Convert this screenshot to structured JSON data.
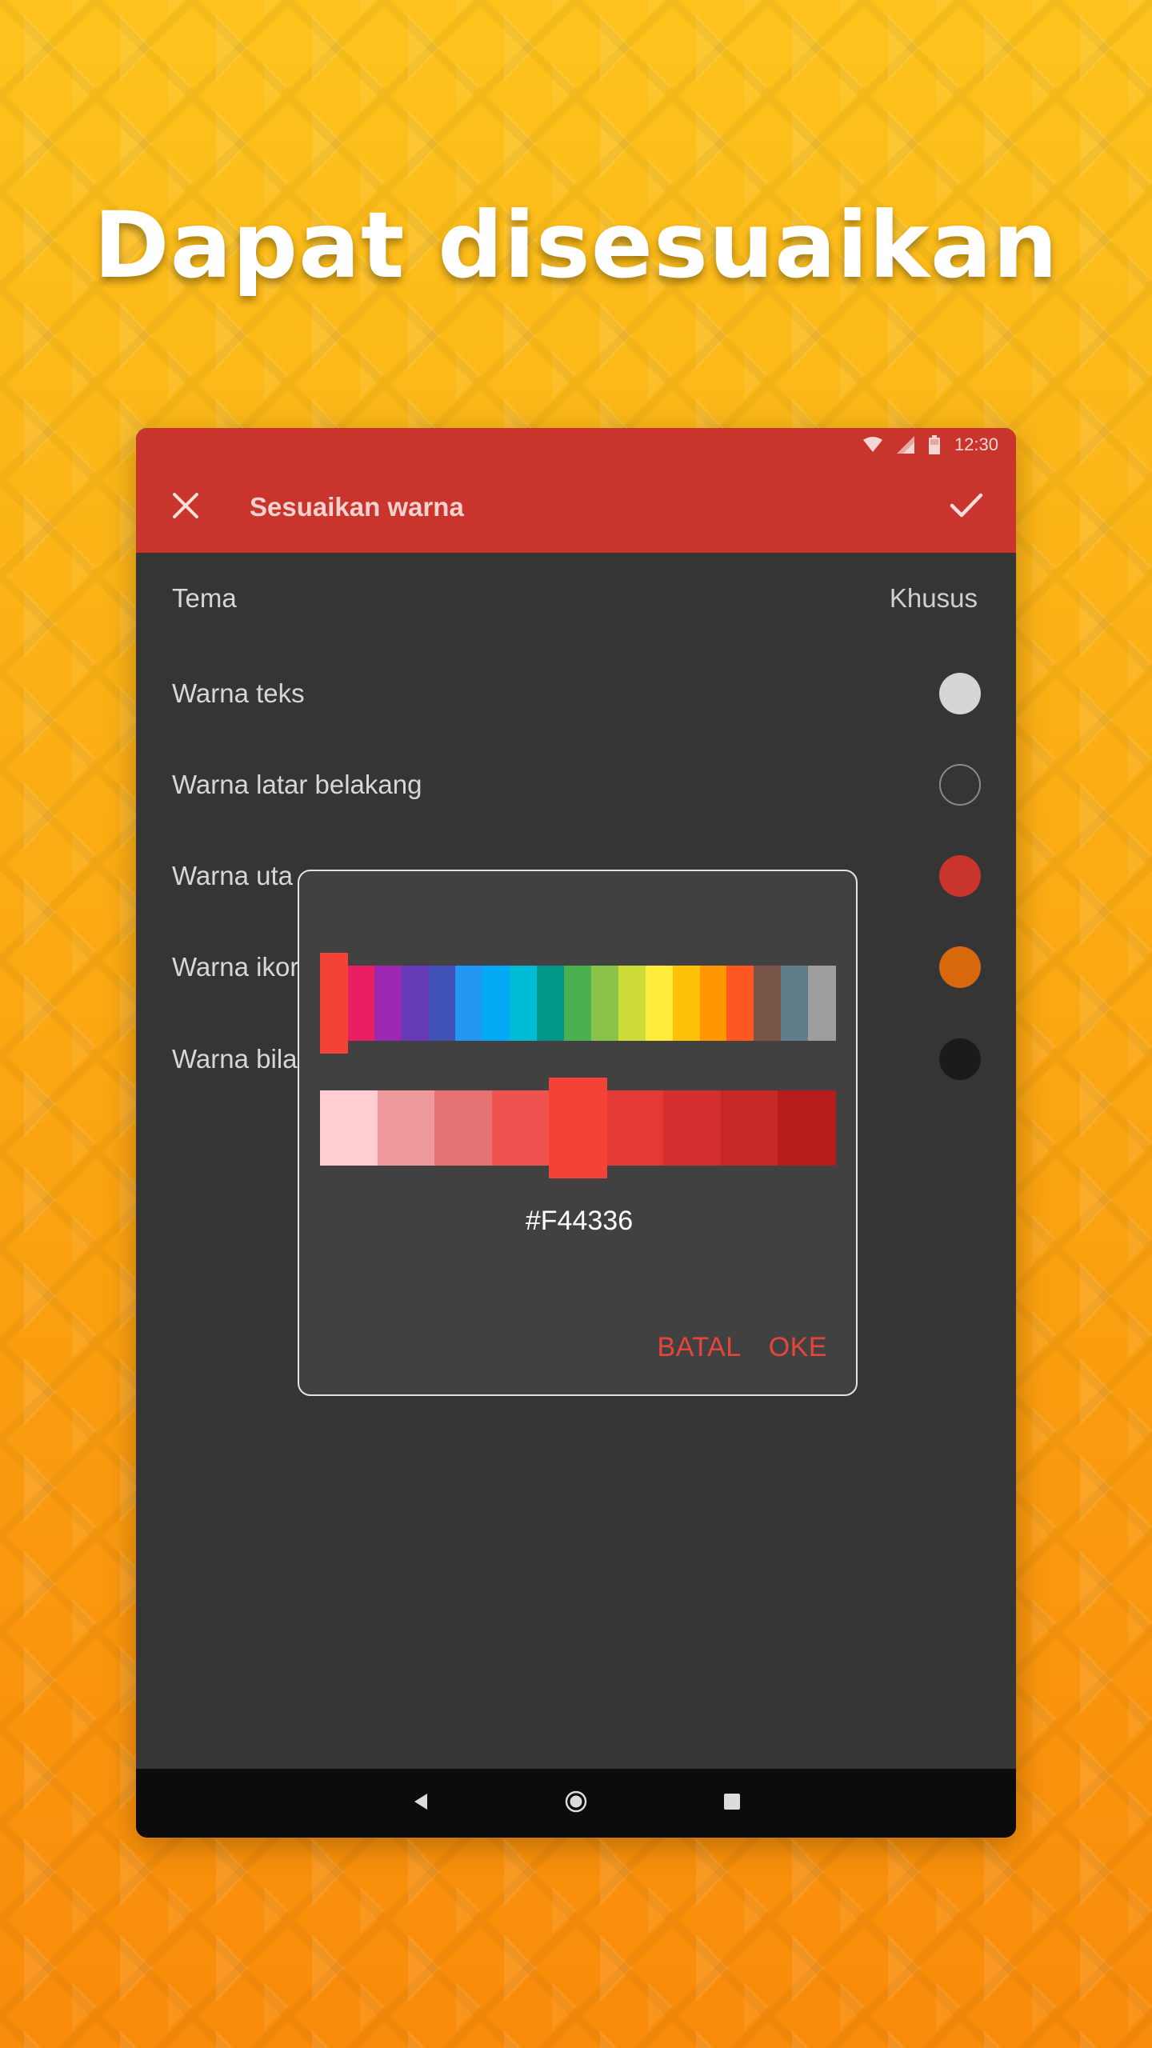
{
  "headline": "Dapat disesuaikan",
  "status_bar": {
    "time": "12:30",
    "icons": [
      "wifi-icon",
      "signal-icon",
      "battery-icon"
    ]
  },
  "app_bar": {
    "title": "Sesuaikan warna",
    "close_icon": "close-icon",
    "confirm_icon": "check-icon"
  },
  "settings": [
    {
      "label": "Tema",
      "value": "Khusus"
    },
    {
      "label": "Warna teks",
      "swatch": "#d6d6d6"
    },
    {
      "label": "Warna latar belakang",
      "swatch": "#363536"
    },
    {
      "label": "Warna uta",
      "swatch": "#c9342c"
    },
    {
      "label": "Warna ikor",
      "swatch": "#d7680c"
    },
    {
      "label": "Warna bila",
      "swatch": "#1b1b1b"
    }
  ],
  "color_dialog": {
    "palette": [
      "#f44336",
      "#e91e63",
      "#9c27b0",
      "#673ab7",
      "#3f51b5",
      "#2196f3",
      "#03a9f4",
      "#00bcd4",
      "#009688",
      "#4caf50",
      "#8bc34a",
      "#cddc39",
      "#ffeb3b",
      "#ffc107",
      "#ff9800",
      "#ff5722",
      "#795548",
      "#607d8b",
      "#9e9e9e"
    ],
    "palette_selected_index": 0,
    "shades": [
      "#ffcdd2",
      "#ef9a9a",
      "#e57373",
      "#ef5350",
      "#f44336",
      "#e53935",
      "#d32f2f",
      "#c62828",
      "#b71c1c"
    ],
    "shades_selected_index": 4,
    "hex_value": "#F44336",
    "cancel_label": "BATAL",
    "ok_label": "OKE",
    "accent": "#e8453a"
  },
  "nav_bar": {
    "icons": [
      "back-icon",
      "home-icon",
      "recents-icon"
    ]
  }
}
